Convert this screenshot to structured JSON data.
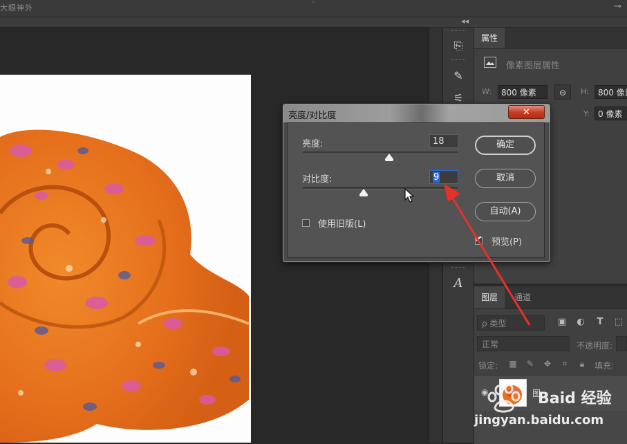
{
  "window": {
    "title_fragment": "大眼神外",
    "collapse_glyph": "◂◂",
    "pin_glyph": "⊸"
  },
  "toolstrip": {
    "tools": [
      {
        "name": "history-icon",
        "glyph": "⎘"
      },
      {
        "name": "brush-preset-icon",
        "glyph": "✎"
      },
      {
        "name": "clone-source-icon",
        "glyph": "⚟"
      },
      {
        "name": "type-character-icon",
        "glyph": "A"
      }
    ]
  },
  "properties_panel": {
    "tab": "属性",
    "layer_kind_label": "像素图层属性",
    "w_label": "W:",
    "w_value": "800 像素",
    "h_label": "H:",
    "h_value": "800 像素",
    "y_label": "Y:",
    "y_value": "0 像素",
    "link_glyph": "⊖"
  },
  "layers_panel": {
    "tabs": [
      "图层",
      "通道"
    ],
    "filter_placeholder": "ρ 类型",
    "blend_mode": "正常",
    "opacity_label": "不透明度:",
    "lock_label": "锁定:",
    "fill_label": "填充:",
    "filter_icons": [
      "image-filter-icon",
      "adjustment-filter-icon",
      "type-filter-icon",
      "shape-filter-icon"
    ],
    "lock_icons": [
      "lock-transparent-icon",
      "lock-paint-icon",
      "lock-move-icon",
      "lock-artboard-icon",
      "lock-all-icon"
    ],
    "layer_name_fragment": "图..."
  },
  "dialog": {
    "title": "亮度/对比度",
    "close_glyph": "✕",
    "brightness_label": "亮度:",
    "brightness_value": "18",
    "contrast_label": "对比度:",
    "contrast_value": "9",
    "legacy_label": "使用旧版(L)",
    "legacy_checked": false,
    "preview_label": "预览(P)",
    "preview_checked": true,
    "ok_label": "确定",
    "cancel_label": "取消",
    "auto_label": "自动(A)",
    "brightness_range": [
      -150,
      150
    ],
    "contrast_range": [
      -50,
      100
    ]
  },
  "watermark": {
    "brand": "Baid 经验",
    "url": "jingyan.baidu.com"
  },
  "colors": {
    "annotation_arrow": "#e8302a",
    "scarf_orange": "#e8731e",
    "dialog_close": "#c23b22"
  }
}
